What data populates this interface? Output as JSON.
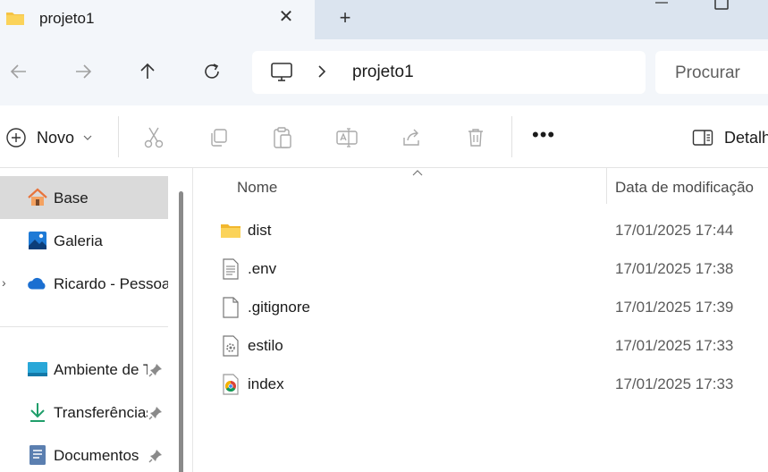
{
  "tab": {
    "title": "projeto1",
    "new_tab_label": "+"
  },
  "address": {
    "path": "projeto1"
  },
  "search": {
    "placeholder": "Procurar"
  },
  "commandbar": {
    "new_label": "Novo",
    "details_label": "Detalhes"
  },
  "sidebar": {
    "items": [
      {
        "label": "Base",
        "icon": "home-icon",
        "selected": true
      },
      {
        "label": "Galeria",
        "icon": "gallery-icon"
      },
      {
        "label": "Ricardo - Pessoal",
        "icon": "onedrive-cloud-icon"
      },
      {
        "label": "Ambiente de Trabalho",
        "icon": "desktop-icon",
        "pinned": true
      },
      {
        "label": "Transferências",
        "icon": "downloads-icon",
        "pinned": true
      },
      {
        "label": "Documentos",
        "icon": "documents-icon",
        "pinned": true
      }
    ]
  },
  "filelist": {
    "columns": {
      "name": "Nome",
      "date": "Data de modificação"
    },
    "rows": [
      {
        "name": "dist",
        "date": "17/01/2025 17:44",
        "icon": "folder-icon"
      },
      {
        "name": ".env",
        "date": "17/01/2025 17:38",
        "icon": "text-file-icon"
      },
      {
        "name": ".gitignore",
        "date": "17/01/2025 17:39",
        "icon": "blank-file-icon"
      },
      {
        "name": "estilo",
        "date": "17/01/2025 17:33",
        "icon": "css-file-icon"
      },
      {
        "name": "index",
        "date": "17/01/2025 17:33",
        "icon": "chrome-html-icon"
      }
    ]
  },
  "colors": {
    "tabstrip": "#dbe4ef",
    "toolbar": "#f3f6fa",
    "selected": "#dadada",
    "folder": "#f7c948",
    "accent": "#0f6cbd"
  }
}
